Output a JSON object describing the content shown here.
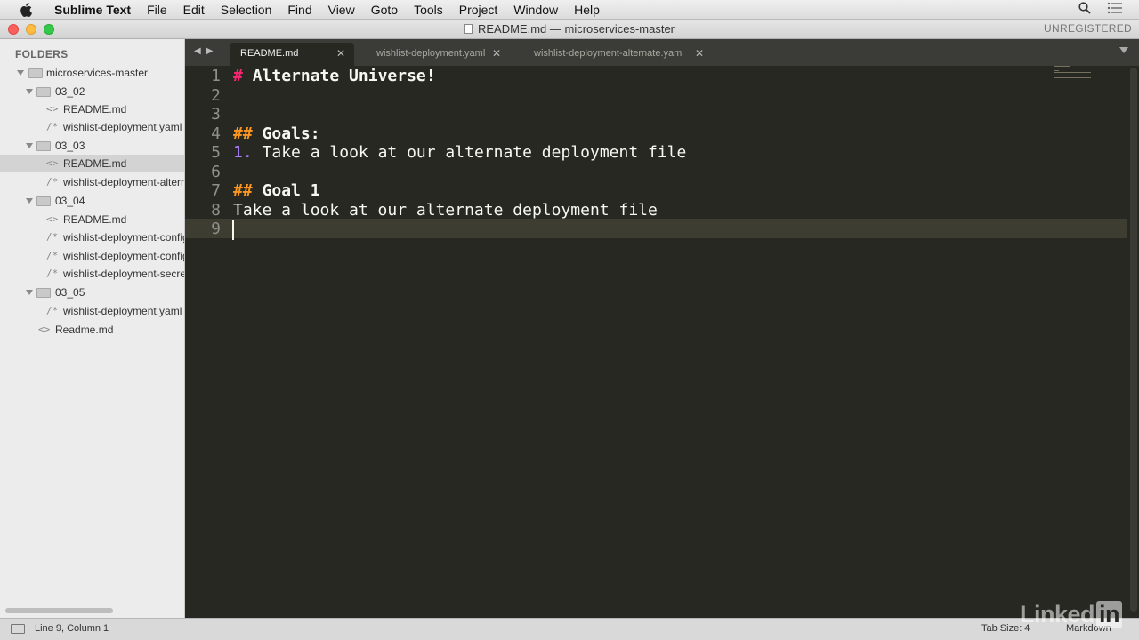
{
  "menubar": {
    "app": "Sublime Text",
    "items": [
      "File",
      "Edit",
      "Selection",
      "Find",
      "View",
      "Goto",
      "Tools",
      "Project",
      "Window",
      "Help"
    ],
    "icons": [
      "apple-icon",
      "search-icon",
      "list-icon"
    ]
  },
  "window": {
    "title": "README.md — microservices-master",
    "registration": "UNREGISTERED"
  },
  "sidebar": {
    "header": "FOLDERS",
    "root": "microservices-master",
    "tree": [
      {
        "label": "03_02",
        "type": "folder",
        "depth": 1
      },
      {
        "label": "README.md",
        "type": "md",
        "depth": 2
      },
      {
        "label": "wishlist-deployment.yaml",
        "type": "yaml",
        "depth": 2
      },
      {
        "label": "03_03",
        "type": "folder",
        "depth": 1
      },
      {
        "label": "README.md",
        "type": "md",
        "depth": 2,
        "selected": true
      },
      {
        "label": "wishlist-deployment-alternate.yaml",
        "type": "yaml",
        "depth": 2
      },
      {
        "label": "03_04",
        "type": "folder",
        "depth": 1
      },
      {
        "label": "README.md",
        "type": "md",
        "depth": 2
      },
      {
        "label": "wishlist-deployment-configmap.yaml",
        "type": "yaml",
        "depth": 2
      },
      {
        "label": "wishlist-deployment-configmap-env.yaml",
        "type": "yaml",
        "depth": 2
      },
      {
        "label": "wishlist-deployment-secret.yaml",
        "type": "yaml",
        "depth": 2
      },
      {
        "label": "03_05",
        "type": "folder",
        "depth": 1
      },
      {
        "label": "wishlist-deployment.yaml",
        "type": "yaml",
        "depth": 2
      },
      {
        "label": "Readme.md",
        "type": "md",
        "depth": 1
      }
    ]
  },
  "tabs": [
    {
      "label": "README.md",
      "active": true
    },
    {
      "label": "wishlist-deployment.yaml",
      "active": false
    },
    {
      "label": "wishlist-deployment-alternate.yaml",
      "active": false
    }
  ],
  "editor": {
    "line_numbers": [
      "1",
      "2",
      "3",
      "4",
      "5",
      "6",
      "7",
      "8",
      "9"
    ],
    "lines": {
      "l1_mark": "#",
      "l1_text": "Alternate Universe!",
      "l4_mark": "##",
      "l4_text": "Goals:",
      "l5_num": "1.",
      "l5_text": "Take a look at our alternate deployment file",
      "l7_mark": "##",
      "l7_text": "Goal 1",
      "l8_text": "Take a look at our alternate deployment file"
    },
    "current_line": 9,
    "colors": {
      "background": "#272822",
      "heading_mark": "#f92672",
      "subheading_mark": "#fd971f",
      "list_number": "#ae81ff"
    }
  },
  "statusbar": {
    "position": "Line 9, Column 1",
    "tab_size": "Tab Size: 4",
    "syntax": "Markdown"
  },
  "watermark": {
    "prefix": "Linked",
    "suffix": "in"
  }
}
